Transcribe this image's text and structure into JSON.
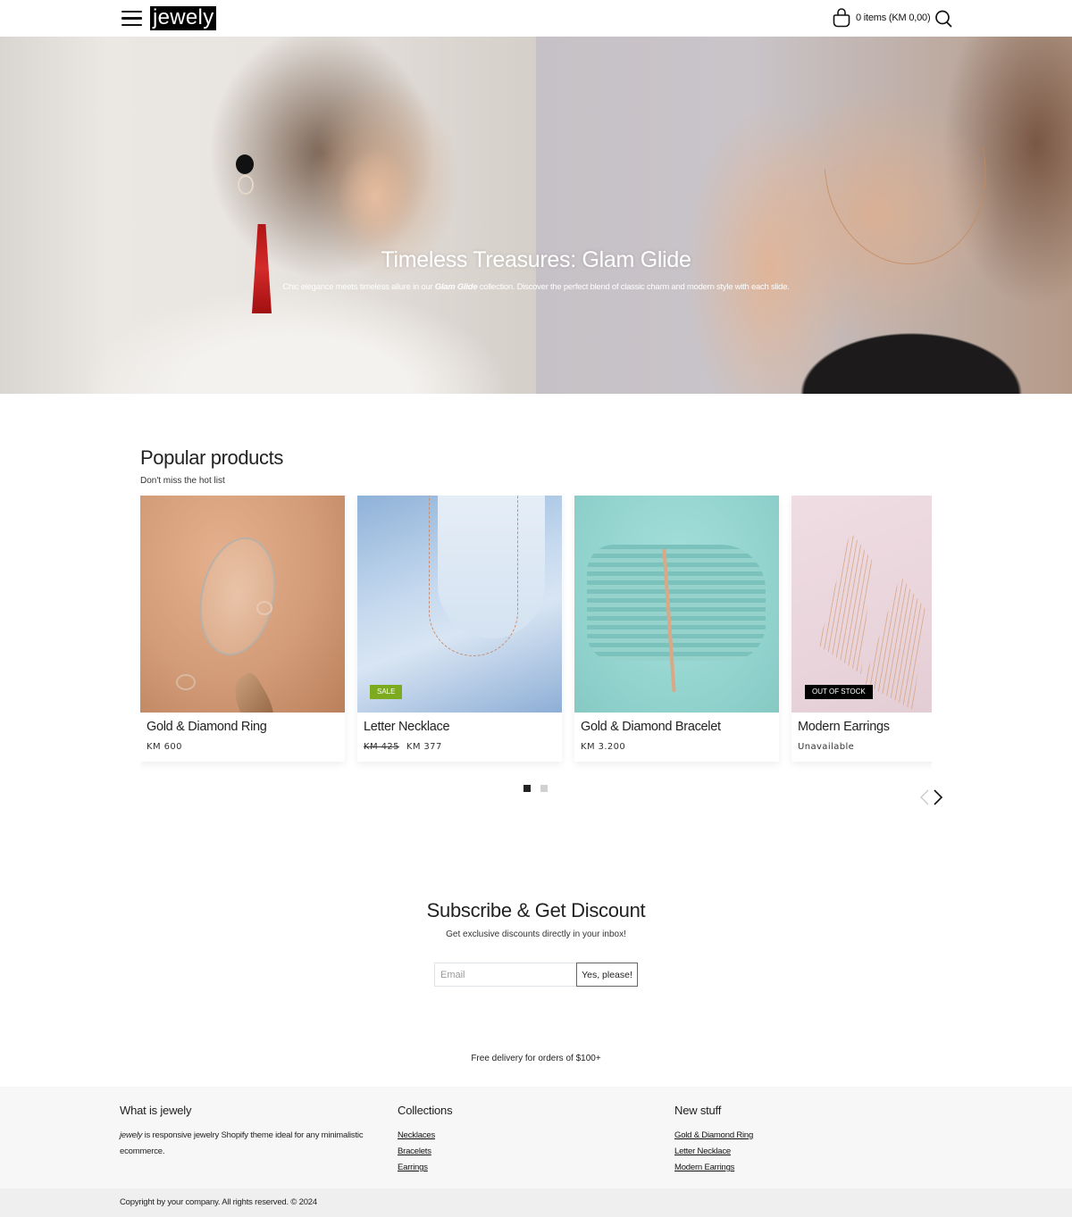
{
  "header": {
    "logo": "jewely",
    "cart_summary": "0 items (KM 0,00)",
    "icons": {
      "menu": "hamburger-icon",
      "cart": "shopping-bag-icon",
      "search": "search-icon"
    }
  },
  "hero": {
    "title": "Timeless Treasures: Glam Glide",
    "subtitle_before": "Chic elegance meets timeless allure in our ",
    "subtitle_emphasis": "Glam Glide",
    "subtitle_after": " collection. Discover the perfect blend of classic charm and modern style with each slide."
  },
  "popular": {
    "title": "Popular products",
    "subtitle": "Don't miss the hot list",
    "products": [
      {
        "name": "Gold & Diamond Ring",
        "price": "KM 600",
        "compare_price": null,
        "badge": null,
        "availability": null
      },
      {
        "name": "Letter Necklace",
        "price": "KM 377",
        "compare_price": "KM 425",
        "badge": "SALE",
        "availability": null
      },
      {
        "name": "Gold & Diamond Bracelet",
        "price": "KM 3.200",
        "compare_price": null,
        "badge": null,
        "availability": null
      },
      {
        "name": "Modern Earrings",
        "price": null,
        "compare_price": null,
        "badge": "OUT OF STOCK",
        "availability": "Unavailable"
      }
    ],
    "pagination": {
      "pages": 2,
      "current": 1
    },
    "colors": {
      "sale_badge": "#7cab1f",
      "oos_badge": "#000000"
    }
  },
  "subscribe": {
    "title": "Subscribe & Get Discount",
    "text": "Get exclusive discounts directly in your inbox!",
    "email_placeholder": "Email",
    "email_value": "",
    "button_label": "Yes, please!"
  },
  "delivery_note": "Free delivery for orders of $100+",
  "footer": {
    "about": {
      "heading": "What is jewely",
      "brand": "jewely",
      "text": " is responsive jewelry Shopify theme ideal for any minimalistic ecommerce."
    },
    "collections": {
      "heading": "Collections",
      "links": [
        "Necklaces",
        "Bracelets",
        "Earrings"
      ]
    },
    "new_stuff": {
      "heading": "New stuff",
      "links": [
        "Gold & Diamond Ring",
        "Letter Necklace",
        "Modern Earrings"
      ]
    },
    "copyright": "Copyright by your company. All rights reserved. © 2024"
  }
}
